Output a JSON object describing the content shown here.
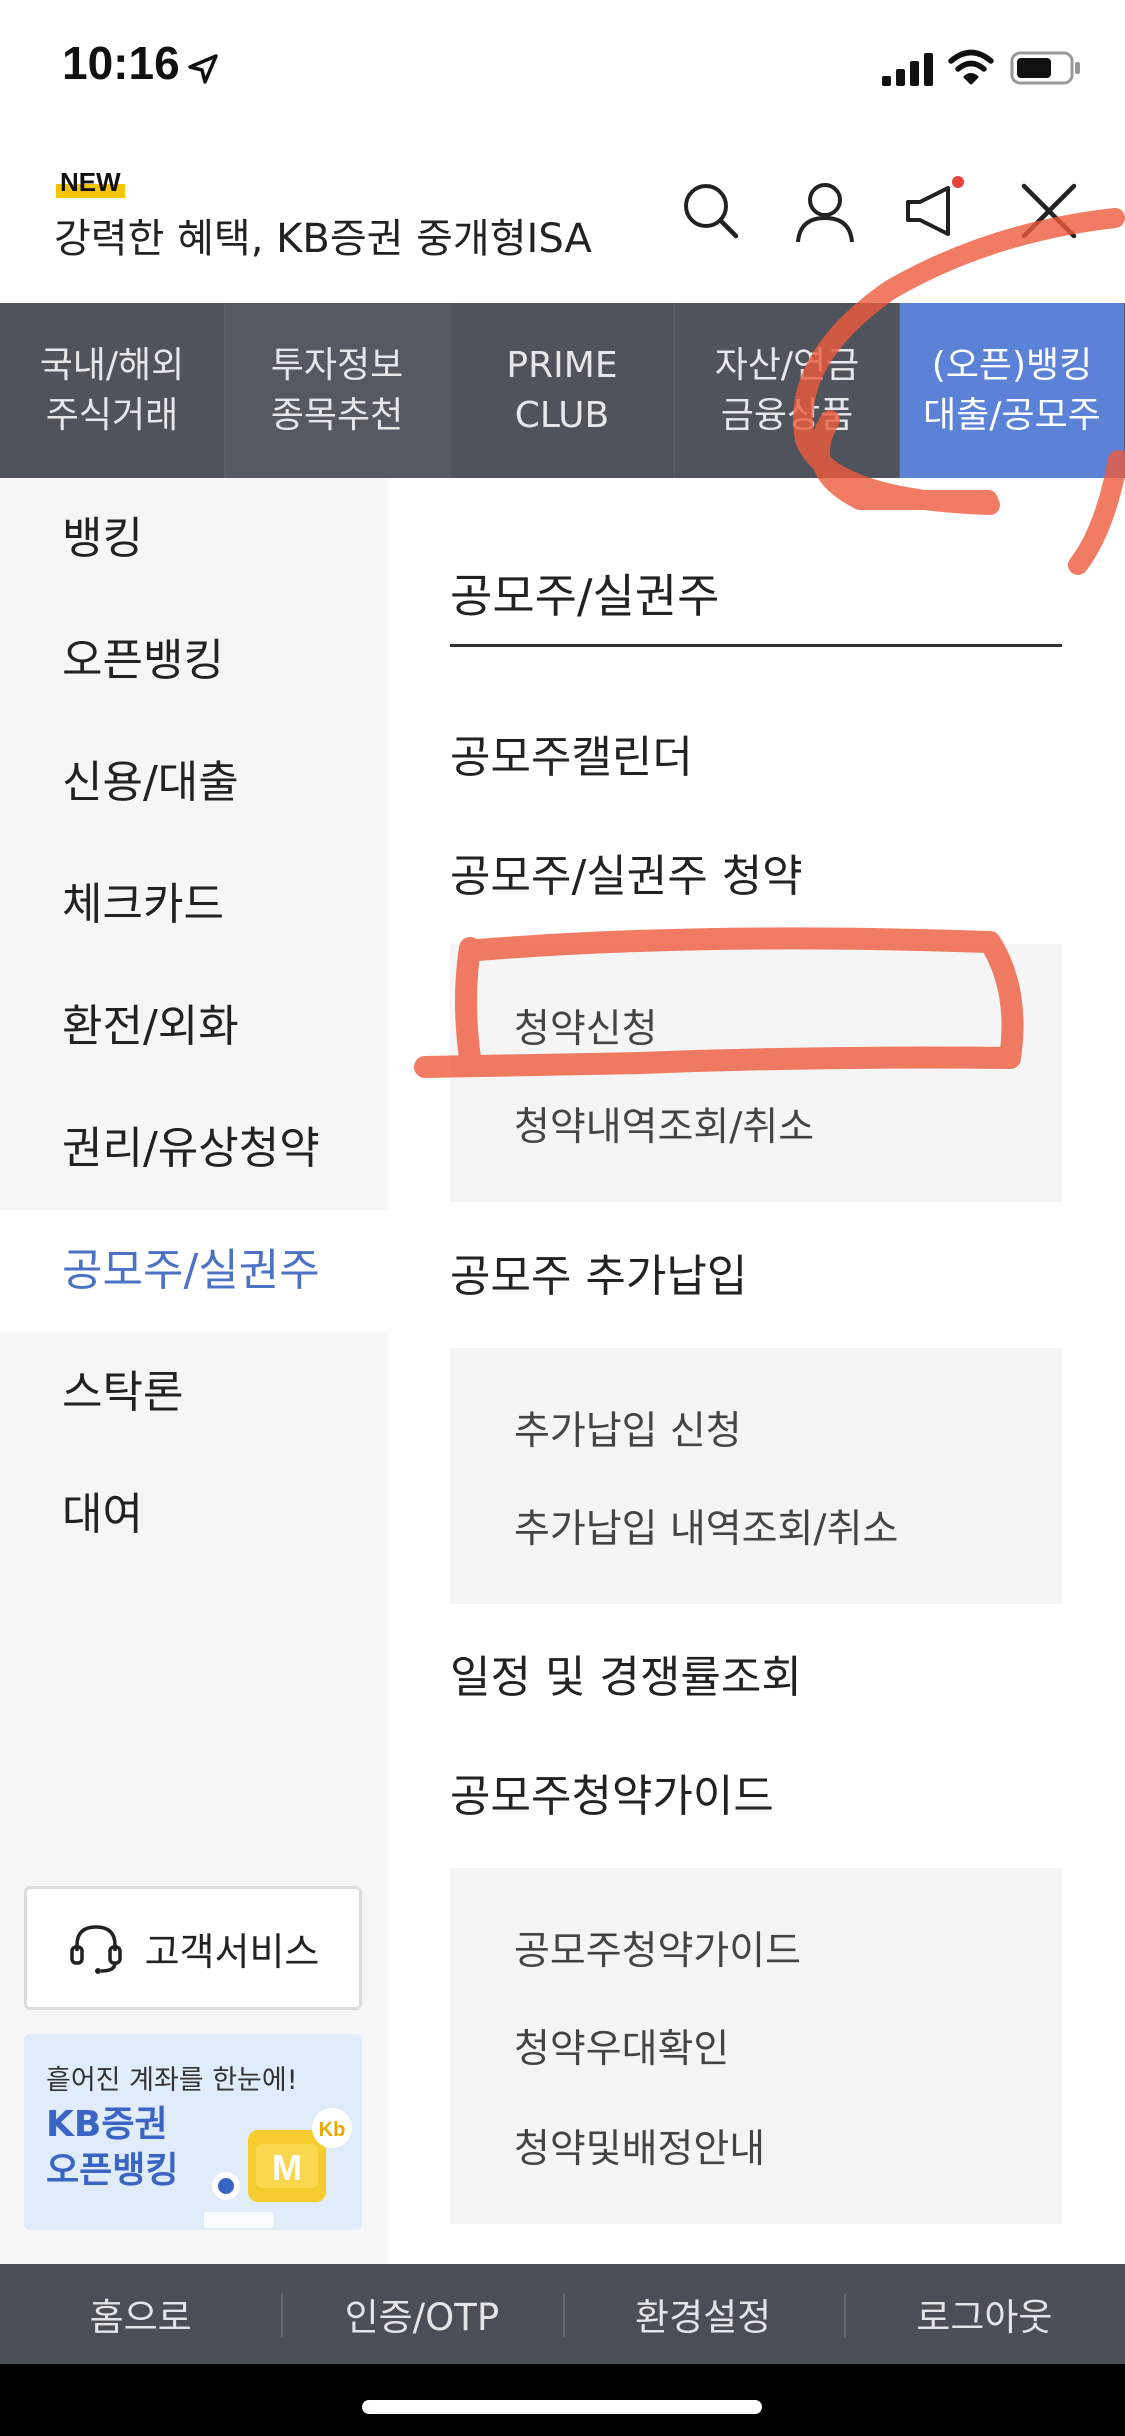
{
  "status_bar": {
    "time": "10:16",
    "icons": [
      "location-arrow-icon",
      "signal-icon",
      "wifi-icon",
      "battery-icon"
    ]
  },
  "header": {
    "badge": "NEW",
    "title": "강력한 혜택, KB증권 중개형ISA",
    "icons": [
      "search-icon",
      "user-icon",
      "speaker-icon",
      "close-icon"
    ]
  },
  "top_nav": {
    "items": [
      {
        "label": "국내/해외\n주식거래",
        "active": false
      },
      {
        "label": "투자정보\n종목추천",
        "active": false
      },
      {
        "label": "PRIME\nCLUB",
        "active": false
      },
      {
        "label": "자산/연금\n금융상품",
        "active": false
      },
      {
        "label": "(오픈)뱅킹\n대출/공모주",
        "active": true
      }
    ]
  },
  "sidebar": {
    "items": [
      {
        "label": "뱅킹"
      },
      {
        "label": "오픈뱅킹"
      },
      {
        "label": "신용/대출"
      },
      {
        "label": "체크카드"
      },
      {
        "label": "환전/외화"
      },
      {
        "label": "권리/유상청약"
      },
      {
        "label": "공모주/실권주"
      },
      {
        "label": "스탁론"
      },
      {
        "label": "대여"
      }
    ],
    "active_label": "공모주/실권주",
    "customer_service": "고객서비스",
    "promo": {
      "subtitle": "흩어진 계좌를 한눈에!",
      "title_line1": "KB증권",
      "title_line2": "오픈뱅킹",
      "badge_letter": "M",
      "logo_text": "Kb"
    }
  },
  "content": {
    "title": "공모주/실권주",
    "sections": [
      {
        "label": "공모주캘린더",
        "subitems": []
      },
      {
        "label": "공모주/실권주 청약",
        "subitems": [
          "청약신청",
          "청약내역조회/취소"
        ]
      },
      {
        "label": "공모주 추가납입",
        "subitems": [
          "추가납입 신청",
          "추가납입 내역조회/취소"
        ]
      },
      {
        "label": "일정 및 경쟁률조회",
        "subitems": []
      },
      {
        "label": "공모주청약가이드",
        "subitems": [
          "공모주청약가이드",
          "청약우대확인",
          "청약및배정안내"
        ]
      }
    ]
  },
  "bottom_bar": {
    "items": [
      "홈으로",
      "인증/OTP",
      "환경설정",
      "로그아웃"
    ]
  },
  "colors": {
    "nav_bg": "#4f535b",
    "nav_active": "#5b82d6",
    "sidebar_active_text": "#4b72c4",
    "annotation": "#ee5a3c"
  }
}
